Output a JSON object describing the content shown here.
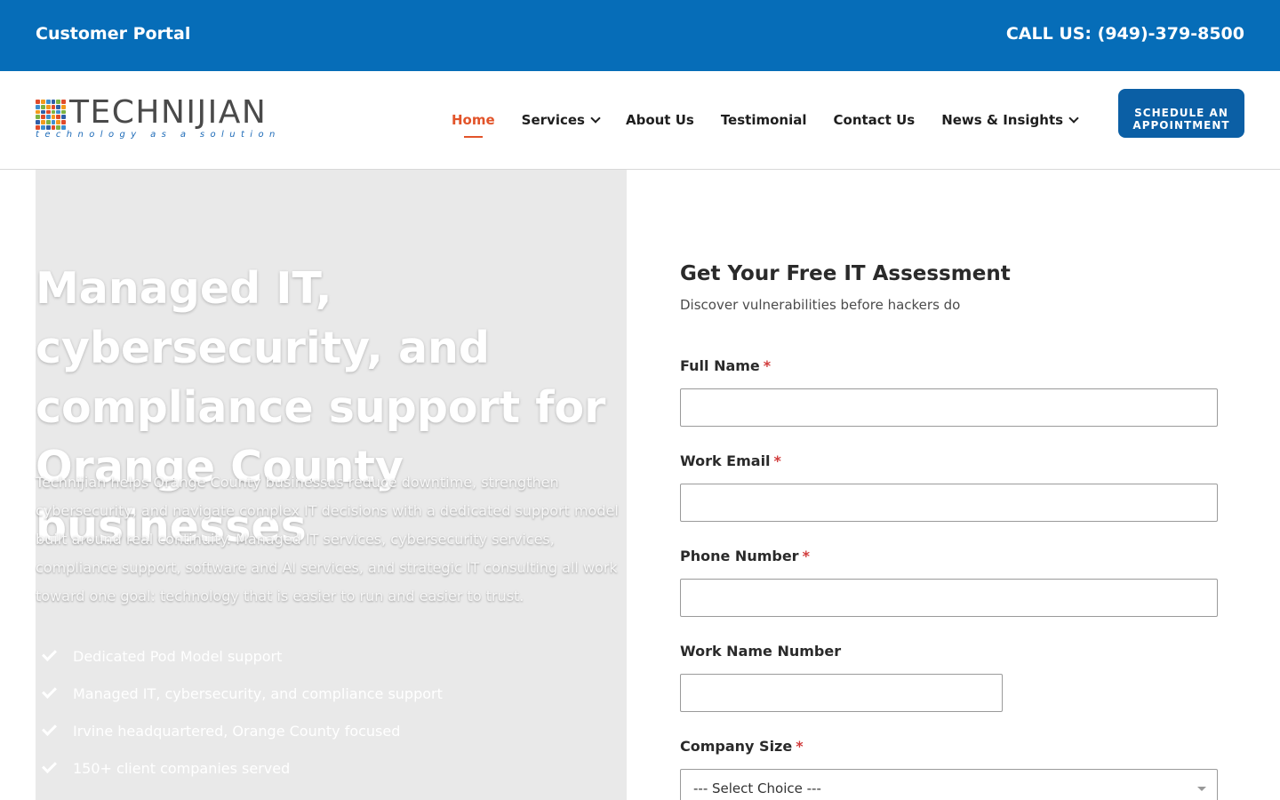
{
  "topbar": {
    "portal_label": "Customer Portal",
    "phone_label": "CALL US: (949)-379-8500",
    "background": "#066db8"
  },
  "brand": {
    "name": "TECHNIJIAN",
    "tagline": "technology as a solution"
  },
  "nav": {
    "items": [
      {
        "label": "Home",
        "active": true
      },
      {
        "label": "Services",
        "dropdown": true
      },
      {
        "label": "About Us"
      },
      {
        "label": "Testimonial"
      },
      {
        "label": "Contact Us"
      },
      {
        "label": "News & Insights",
        "dropdown": true
      }
    ],
    "active_color": "#e2542a"
  },
  "cta": {
    "line1": "SCHEDULE AN",
    "line2": "APPOINTMENT",
    "color": "#0b5fa5"
  },
  "hero": {
    "heading": "Managed IT, cybersecurity, and compliance support for Orange County businesses",
    "body": "Technijian helps Orange County businesses reduce downtime, strengthen cybersecurity, and navigate complex IT decisions with a dedicated support model built around real continuity. Managed IT services, cybersecurity services, compliance support, software and AI services, and strategic IT consulting all work toward one goal: technology that is easier to run and easier to trust.",
    "bullets": [
      "Dedicated Pod Model support",
      "Managed IT, cybersecurity, and compliance support",
      "Irvine headquartered, Orange County focused",
      "150+ client companies served"
    ]
  },
  "form": {
    "title": "Get Your Free IT Assessment",
    "subtitle": "Discover vulnerabilities before hackers do",
    "fields": {
      "full_name": {
        "label": "Full Name",
        "required_mark": "*",
        "value": ""
      },
      "work_email": {
        "label": "Work Email",
        "required_mark": "*",
        "value": ""
      },
      "phone": {
        "label": "Phone Number",
        "required_mark": "*",
        "value": ""
      },
      "work_name_number": {
        "label": "Work Name Number",
        "value": ""
      },
      "company_size": {
        "label": "Company Size",
        "required_mark": "*",
        "selected": "--- Select Choice ---"
      }
    }
  }
}
